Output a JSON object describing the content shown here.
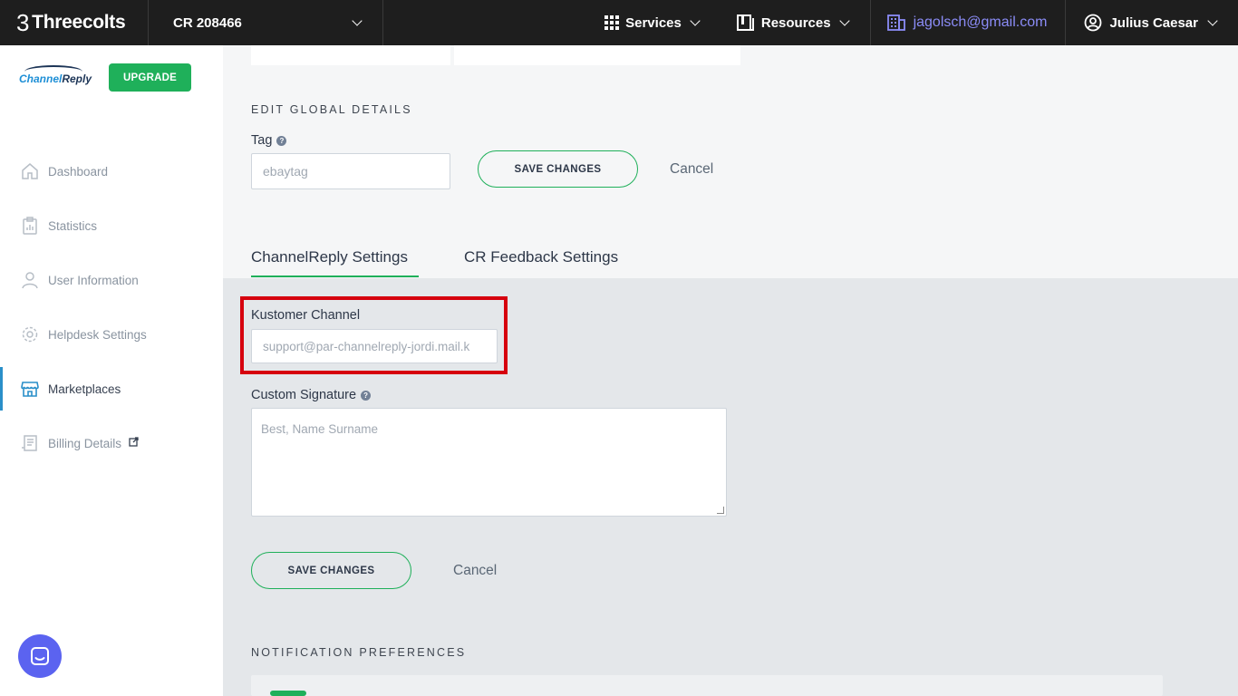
{
  "topbar": {
    "brand": "Threecolts",
    "account": "CR 208466",
    "services": "Services",
    "resources": "Resources",
    "email": "jagolsch@gmail.com",
    "user": "Julius Caesar"
  },
  "sidebar": {
    "logo": {
      "prefix": "Channel",
      "suffix": "Reply"
    },
    "upgrade": "UPGRADE",
    "items": [
      {
        "label": "Dashboard",
        "icon": "home-icon"
      },
      {
        "label": "Statistics",
        "icon": "clipboard-chart-icon"
      },
      {
        "label": "User Information",
        "icon": "user-icon"
      },
      {
        "label": "Helpdesk Settings",
        "icon": "gear-icon"
      },
      {
        "label": "Marketplaces",
        "icon": "storefront-icon",
        "active": true
      },
      {
        "label": "Billing Details",
        "icon": "receipt-icon"
      }
    ]
  },
  "main": {
    "edit_global_title": "EDIT GLOBAL DETAILS",
    "tag_label": "Tag",
    "tag_placeholder": "ebaytag",
    "save_label": "SAVE CHANGES",
    "cancel_label": "Cancel",
    "tabs": [
      {
        "label": "ChannelReply Settings",
        "active": true
      },
      {
        "label": "CR Feedback Settings",
        "active": false
      }
    ],
    "channel_label": "Kustomer Channel",
    "channel_placeholder": "support@par-channelreply-jordi.mail.k",
    "signature_label": "Custom Signature",
    "signature_placeholder": "Best, Name Surname",
    "save_label_2": "SAVE CHANGES",
    "cancel_label_2": "Cancel",
    "notification_title": "NOTIFICATION PREFERENCES"
  },
  "colors": {
    "accent_green": "#1fb05a",
    "highlight_red": "#d6000e",
    "email_purple": "#8b8cf7",
    "active_blue": "#2a8fc9"
  }
}
